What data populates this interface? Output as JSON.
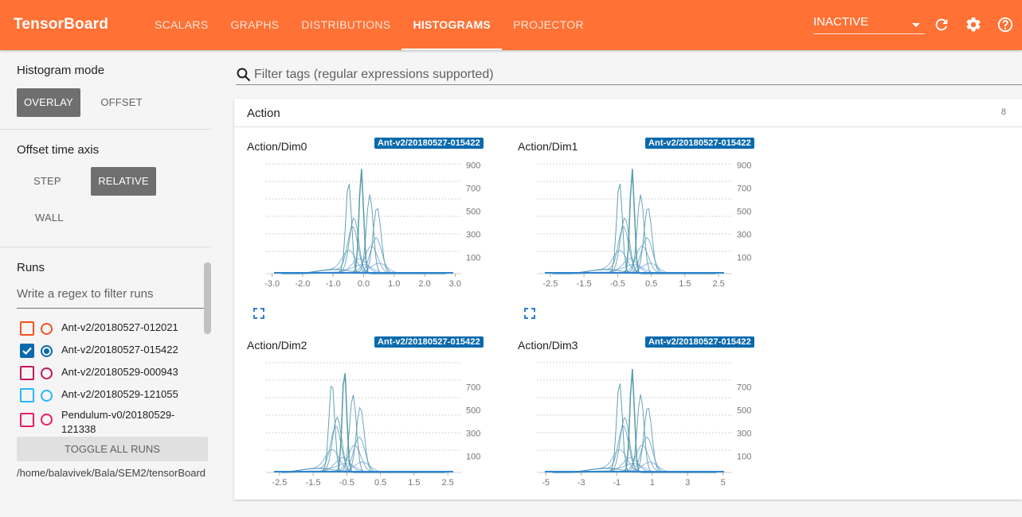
{
  "app": {
    "title": "TensorBoard"
  },
  "nav": {
    "tabs": [
      "SCALARS",
      "GRAPHS",
      "DISTRIBUTIONS",
      "HISTOGRAMS",
      "PROJECTOR"
    ],
    "active": "HISTOGRAMS"
  },
  "toolbar": {
    "run_status": "INACTIVE",
    "icons": [
      "refresh-icon",
      "settings-icon",
      "help-icon"
    ]
  },
  "sidebar": {
    "histogram_mode": {
      "title": "Histogram mode",
      "options": [
        "OVERLAY",
        "OFFSET"
      ],
      "selected": "OVERLAY"
    },
    "offset_time_axis": {
      "title": "Offset time axis",
      "options": [
        "STEP",
        "RELATIVE",
        "WALL"
      ],
      "selected": "RELATIVE"
    },
    "runs": {
      "title": "Runs",
      "filter_placeholder": "Write a regex to filter runs",
      "items": [
        {
          "label": "Ant-v2/20180527-012021",
          "color": "#f4511e",
          "checked": false,
          "selected": false
        },
        {
          "label": "Ant-v2/20180527-015422",
          "color": "#0b6aad",
          "checked": true,
          "selected": true
        },
        {
          "label": "Ant-v2/20180529-000943",
          "color": "#c2185b",
          "checked": false,
          "selected": false
        },
        {
          "label": "Ant-v2/20180529-121055",
          "color": "#29b6f6",
          "checked": false,
          "selected": false
        },
        {
          "label": "Pendulum-v0/20180529-121338",
          "color": "#e91e63",
          "checked": false,
          "selected": false
        }
      ],
      "toggle_all_label": "TOGGLE ALL RUNS",
      "logdir": "/home/balavivek/Bala/SEM2/tensorBoard"
    }
  },
  "main": {
    "filter_placeholder": "Filter tags (regular expressions supported)",
    "category": {
      "title": "Action",
      "count": "8"
    },
    "cards": [
      {
        "title": "Action/Dim0",
        "run": "Ant-v2/20180527-015422"
      },
      {
        "title": "Action/Dim1",
        "run": "Ant-v2/20180527-015422"
      },
      {
        "title": "Action/Dim2",
        "run": "Ant-v2/20180527-015422"
      },
      {
        "title": "Action/Dim3",
        "run": "Ant-v2/20180527-015422"
      }
    ]
  },
  "chart_data": [
    {
      "type": "area",
      "title": "Action/Dim0",
      "x_ticks": [
        "-3.0",
        "-2.0",
        "-1.0",
        "0.0",
        "1.0",
        "2.0",
        "3.0"
      ],
      "x_values": [
        -3,
        -2,
        -1,
        0,
        1,
        2,
        3
      ],
      "xlim": [
        -3.2,
        3.2
      ],
      "y_ticks": [
        "900",
        "700",
        "500",
        "300",
        "100"
      ],
      "y_values": [
        900,
        700,
        500,
        300,
        100
      ],
      "peak": 910,
      "center": 0
    },
    {
      "type": "area",
      "title": "Action/Dim1",
      "x_ticks": [
        "-2.5",
        "-1.5",
        "-0.5",
        "0.5",
        "1.5",
        "2.5"
      ],
      "x_values": [
        -2.5,
        -1.5,
        -0.5,
        0.5,
        1.5,
        2.5
      ],
      "xlim": [
        -2.9,
        2.9
      ],
      "y_ticks": [
        "900",
        "700",
        "500",
        "300",
        "100"
      ],
      "y_values": [
        900,
        700,
        500,
        300,
        100
      ],
      "peak": 910,
      "center": 0
    },
    {
      "type": "area",
      "title": "Action/Dim2",
      "x_ticks": [
        "-2.5",
        "-1.5",
        "-0.5",
        "0.5",
        "1.5",
        "2.5"
      ],
      "x_values": [
        -2.5,
        -1.5,
        -0.5,
        0.5,
        1.5,
        2.5
      ],
      "xlim": [
        -2.9,
        2.9
      ],
      "y_ticks": [
        "700",
        "500",
        "300",
        "100"
      ],
      "y_values": [
        700,
        500,
        300,
        100
      ],
      "peak": 900,
      "center": -0.5
    },
    {
      "type": "area",
      "title": "Action/Dim3",
      "x_ticks": [
        "-5",
        "-3",
        "-1",
        "1",
        "3",
        "5"
      ],
      "x_values": [
        -5,
        -3,
        -1,
        1,
        3,
        5
      ],
      "xlim": [
        -5.5,
        5.5
      ],
      "y_ticks": [
        "700",
        "500",
        "300",
        "100"
      ],
      "y_values": [
        700,
        500,
        300,
        100
      ],
      "peak": 900,
      "center": 0
    }
  ]
}
